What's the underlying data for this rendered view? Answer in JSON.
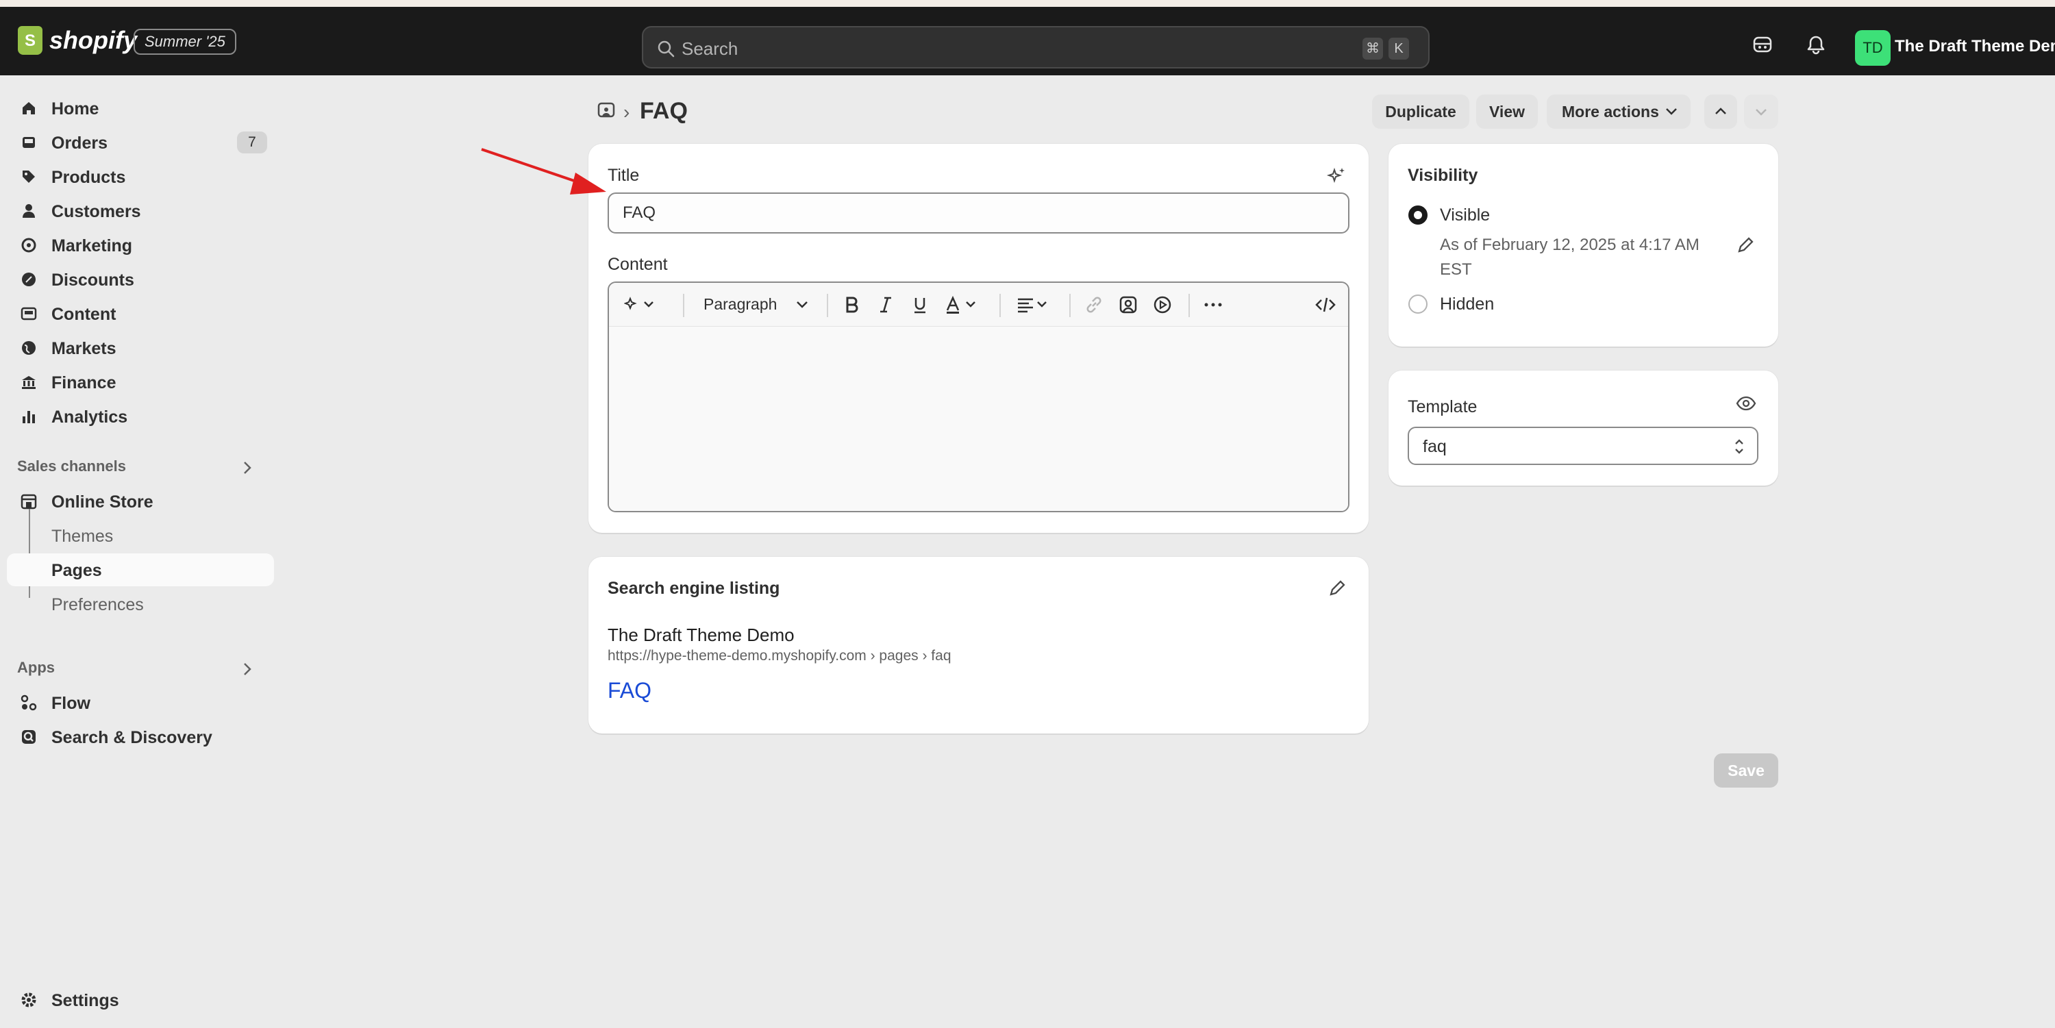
{
  "topbar": {
    "logo_text": "shopify",
    "logo_glyph": "S",
    "edition_badge": "Summer '25",
    "search_placeholder": "Search",
    "shortcut_keys": [
      "⌘",
      "K"
    ],
    "store_initials": "TD",
    "store_name": "The Draft Theme Demo",
    "icons": [
      "shopify-logo-icon",
      "search-icon",
      "sidekick-icon",
      "bell-icon"
    ]
  },
  "sidebar": {
    "items": [
      {
        "label": "Home",
        "icon": "home-icon"
      },
      {
        "label": "Orders",
        "icon": "inbox-icon",
        "badge": "7"
      },
      {
        "label": "Products",
        "icon": "tag-icon"
      },
      {
        "label": "Customers",
        "icon": "person-icon"
      },
      {
        "label": "Marketing",
        "icon": "target-icon"
      },
      {
        "label": "Discounts",
        "icon": "discount-icon"
      },
      {
        "label": "Content",
        "icon": "content-icon"
      },
      {
        "label": "Markets",
        "icon": "globe-icon"
      },
      {
        "label": "Finance",
        "icon": "bank-icon"
      },
      {
        "label": "Analytics",
        "icon": "bar-chart-icon"
      }
    ],
    "sales_channels_label": "Sales channels",
    "online_store": {
      "label": "Online Store",
      "icon": "store-icon"
    },
    "online_store_sub": [
      {
        "label": "Themes"
      },
      {
        "label": "Pages",
        "active": true
      },
      {
        "label": "Preferences"
      }
    ],
    "apps_label": "Apps",
    "apps": [
      {
        "label": "Flow",
        "icon": "flow-icon"
      },
      {
        "label": "Search & Discovery",
        "icon": "search-discovery-icon"
      }
    ],
    "settings_label": "Settings"
  },
  "page": {
    "breadcrumb_icon": "pages-icon",
    "separator": "›",
    "title": "FAQ",
    "actions": {
      "duplicate": "Duplicate",
      "view": "View",
      "more_actions": "More actions"
    }
  },
  "main_card": {
    "title_label": "Title",
    "title_value": "FAQ",
    "content_label": "Content",
    "toolbar": {
      "format_value": "Paragraph",
      "tools": [
        "magic-icon",
        "bold-icon",
        "italic-icon",
        "underline-icon",
        "text-color-icon",
        "align-icon",
        "link-icon",
        "image-icon",
        "video-icon",
        "more-icon",
        "code-icon"
      ]
    }
  },
  "seo_card": {
    "heading": "Search engine listing",
    "store_name": "The Draft Theme Demo",
    "url": "https://hype-theme-demo.myshopify.com › pages › faq",
    "page_title": "FAQ"
  },
  "visibility_card": {
    "heading": "Visibility",
    "options": [
      {
        "label": "Visible",
        "selected": true
      },
      {
        "label": "Hidden",
        "selected": false
      }
    ],
    "visible_since": "As of February 12, 2025 at 4:17 AM EST"
  },
  "template_card": {
    "heading": "Template",
    "value": "faq"
  },
  "save_label": "Save",
  "colors": {
    "topbar": "#1a1a1a",
    "canvas": "#ebebeb",
    "avatar": "#3de078",
    "link": "#1a4bd6",
    "annotation_arrow": "#e02020"
  }
}
